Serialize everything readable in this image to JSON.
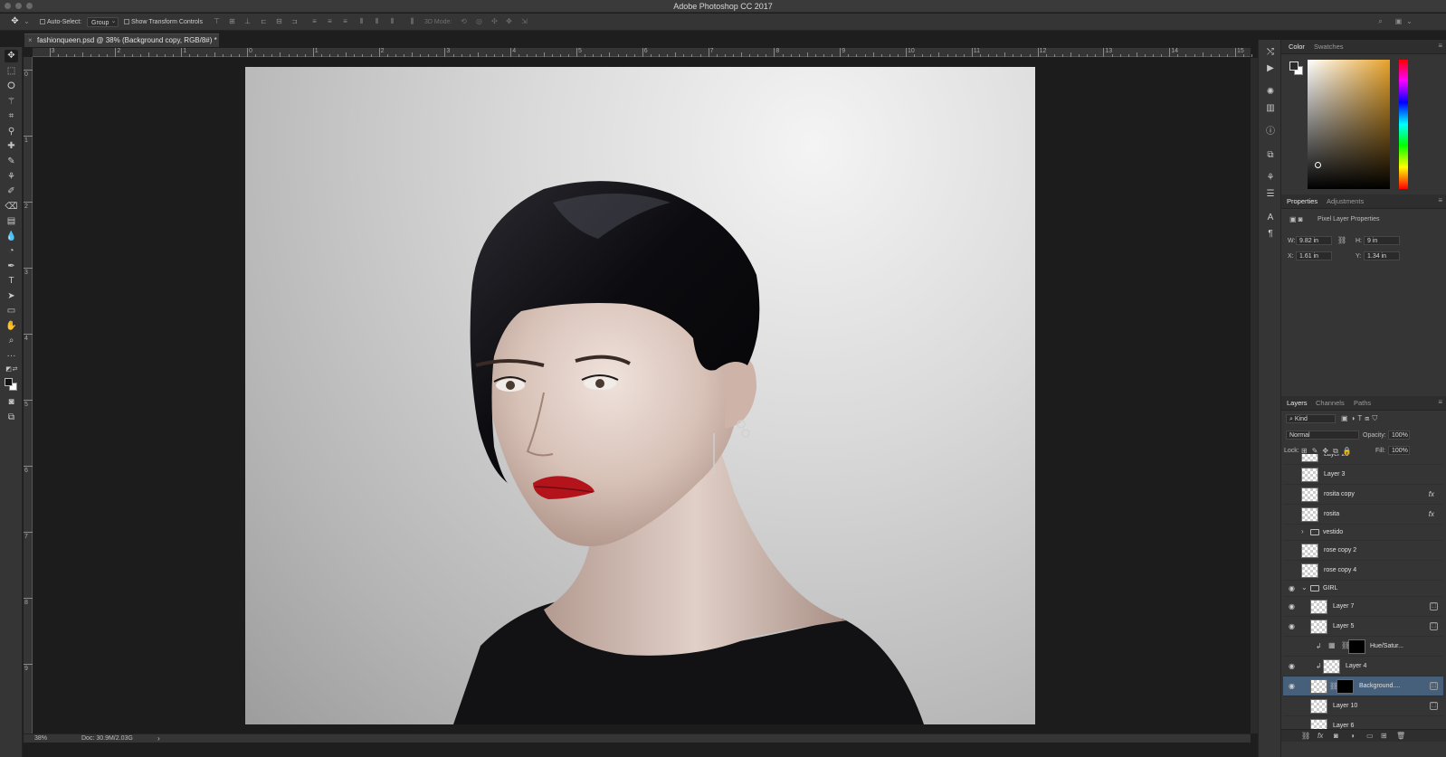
{
  "window": {
    "title": "Adobe Photoshop CC 2017"
  },
  "options_bar": {
    "auto_select_label": "Auto-Select:",
    "auto_select_value": "Group",
    "show_transform_label": "Show Transform Controls",
    "mode_3d_label": "3D Mode:"
  },
  "document_tab": {
    "title": "fashionqueen.psd @ 38% (Background copy, RGB/8#) *",
    "close": "×"
  },
  "ruler_h": [
    "3",
    "2",
    "1",
    "0",
    "1",
    "2",
    "3",
    "4",
    "5",
    "6",
    "7",
    "8",
    "9",
    "10",
    "11",
    "12",
    "13",
    "14",
    "15"
  ],
  "ruler_v": [
    "0",
    "1",
    "2",
    "3",
    "4",
    "5",
    "6",
    "7",
    "8",
    "9"
  ],
  "status_bar": {
    "zoom": "38%",
    "doc": "Doc: 30.9M/2.03G",
    "arrow": "›"
  },
  "color_panel": {
    "tabs": [
      "Color",
      "Swatches"
    ],
    "accent": "#e8a32a"
  },
  "properties_panel": {
    "tabs": [
      "Properties",
      "Adjustments"
    ],
    "heading": "Pixel Layer Properties",
    "w_label": "W:",
    "w_value": "9.82 in",
    "h_label": "H:",
    "h_value": "9 in",
    "x_label": "X:",
    "x_value": "1.61 in",
    "y_label": "Y:",
    "y_value": "1.34 in"
  },
  "layers_panel": {
    "tabs": [
      "Layers",
      "Channels",
      "Paths"
    ],
    "filter_label": "Kind",
    "blend_mode": "Normal",
    "opacity_label": "Opacity:",
    "opacity_value": "100%",
    "lock_label": "Lock:",
    "fill_label": "Fill:",
    "fill_value": "100%",
    "layers": [
      {
        "name": "Layer 23",
        "visible": false
      },
      {
        "name": "Layer 3",
        "visible": false
      },
      {
        "name": "rosita copy",
        "visible": false,
        "fx": "fx"
      },
      {
        "name": "rosita",
        "visible": false,
        "fx": "fx"
      },
      {
        "name": "vestido",
        "visible": false,
        "group": true,
        "expanded": false
      },
      {
        "name": "rose copy 2",
        "visible": false
      },
      {
        "name": "rose copy 4",
        "visible": false
      },
      {
        "name": "GIRL",
        "visible": true,
        "group": true,
        "expanded": true
      },
      {
        "name": "Layer 7",
        "visible": true
      },
      {
        "name": "Layer 5",
        "visible": true
      },
      {
        "name": "Hue/Satur...",
        "visible": false,
        "adjustment": true
      },
      {
        "name": "Layer 4",
        "visible": true
      },
      {
        "name": "Background....",
        "visible": true,
        "selected": true
      },
      {
        "name": "Layer 10",
        "visible": false
      },
      {
        "name": "Layer 6",
        "visible": false
      }
    ]
  }
}
